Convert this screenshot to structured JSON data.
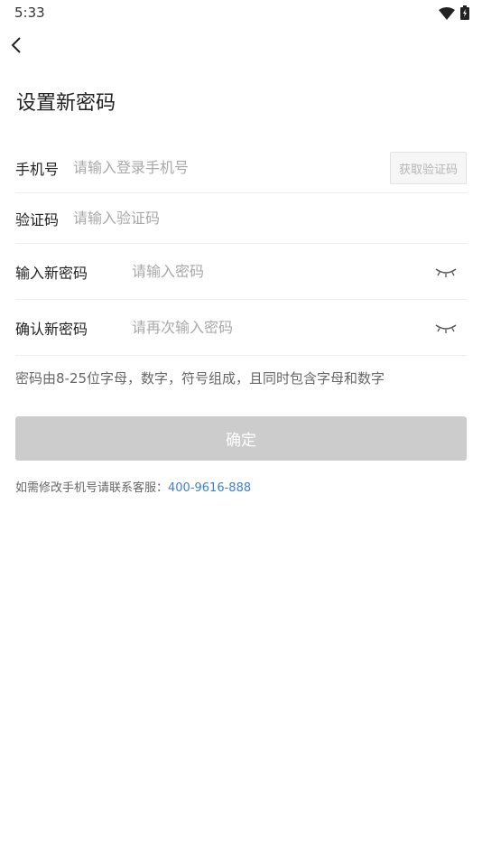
{
  "status_bar": {
    "time": "5:33"
  },
  "header": {
    "title": "设置新密码"
  },
  "form": {
    "phone": {
      "label": "手机号",
      "placeholder": "请输入登录手机号"
    },
    "get_code_label": "获取验证码",
    "code": {
      "label": "验证码",
      "placeholder": "请输入验证码"
    },
    "new_password": {
      "label": "输入新密码",
      "placeholder": "请输入密码"
    },
    "confirm_password": {
      "label": "确认新密码",
      "placeholder": "请再次输入密码"
    }
  },
  "hint": "密码由8-25位字母，数字，符号组成，且同时包含字母和数字",
  "confirm_label": "确定",
  "contact": {
    "prefix": "如需修改手机号请联系客服：",
    "phone": "400-9616-888"
  },
  "colors": {
    "button_disabled": "#cccccc",
    "link": "#3b7fd6"
  }
}
